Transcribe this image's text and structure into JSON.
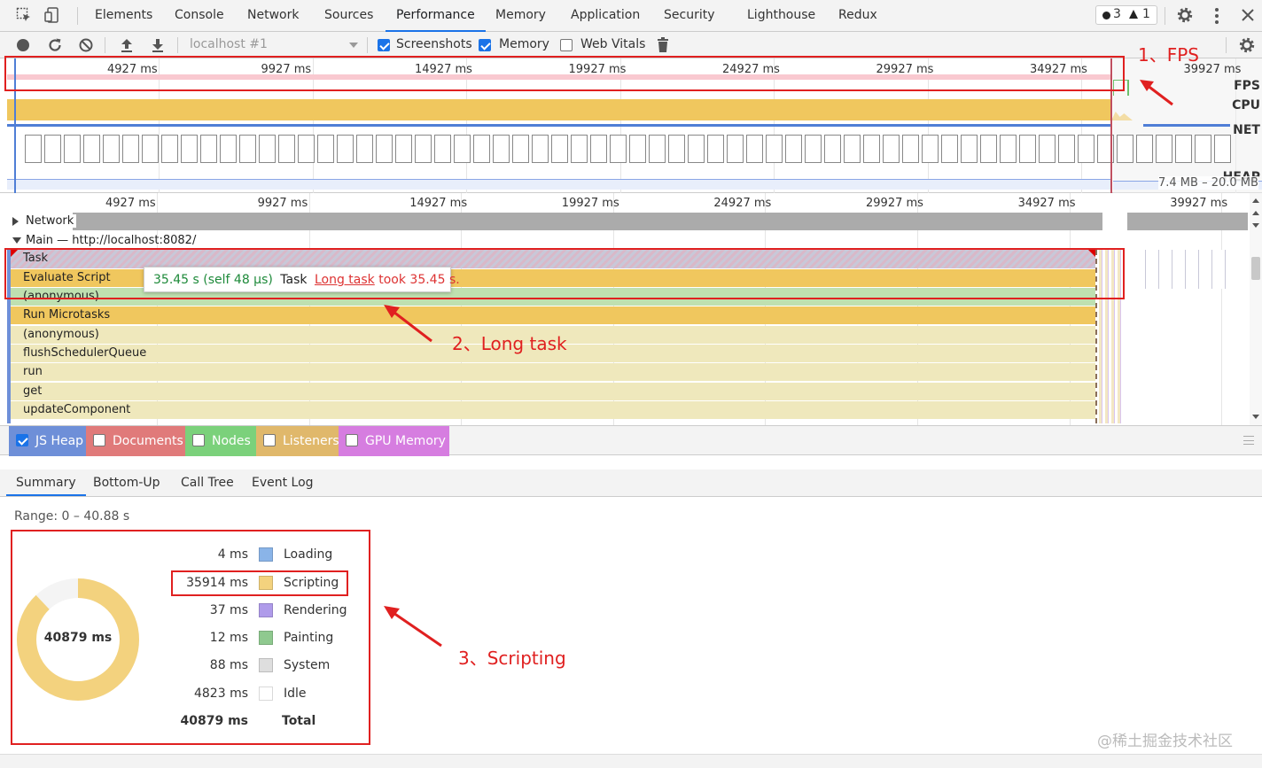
{
  "tabs": [
    {
      "label": "Elements"
    },
    {
      "label": "Console"
    },
    {
      "label": "Network"
    },
    {
      "label": "Sources"
    },
    {
      "label": "Performance"
    },
    {
      "label": "Memory"
    },
    {
      "label": "Application"
    },
    {
      "label": "Security"
    },
    {
      "label": "Lighthouse"
    },
    {
      "label": "Redux"
    }
  ],
  "issues": {
    "errors": "3",
    "warnings": "1"
  },
  "toolbar": {
    "target": "localhost #1",
    "screenshots_label": "Screenshots",
    "memory_label": "Memory",
    "webvitals_label": "Web Vitals"
  },
  "overview": {
    "ticks": [
      "4927 ms",
      "9927 ms",
      "14927 ms",
      "19927 ms",
      "24927 ms",
      "29927 ms",
      "34927 ms",
      "39927 ms"
    ],
    "fps_label": "FPS",
    "cpu_label": "CPU",
    "net_label": "NET",
    "heap_label": "HEAP",
    "heap_range": "7.4 MB – 20.0 MB"
  },
  "flame": {
    "ticks": [
      "4927 ms",
      "9927 ms",
      "14927 ms",
      "19927 ms",
      "24927 ms",
      "29927 ms",
      "34927 ms",
      "39927 ms"
    ],
    "network_label": "Network",
    "main_label": "Main — http://localhost:8082/",
    "rows": [
      "Task",
      "Evaluate Script",
      "(anonymous)",
      "Run Microtasks",
      "(anonymous)",
      "flushSchedulerQueue",
      "run",
      "get",
      "updateComponent"
    ],
    "tooltip": {
      "time": "35.45 s (self 48 µs)",
      "name": "Task",
      "link": "Long task",
      "message": "took 35.45 s."
    }
  },
  "counters": [
    {
      "label": "JS Heap",
      "checked": true,
      "color": "#6e8fd8"
    },
    {
      "label": "Documents",
      "checked": false,
      "color": "#e07a7a"
    },
    {
      "label": "Nodes",
      "checked": false,
      "color": "#7bd17b"
    },
    {
      "label": "Listeners",
      "checked": false,
      "color": "#e0b86b"
    },
    {
      "label": "GPU Memory",
      "checked": false,
      "color": "#d67de0"
    }
  ],
  "bottom_tabs": [
    {
      "label": "Summary"
    },
    {
      "label": "Bottom-Up"
    },
    {
      "label": "Call Tree"
    },
    {
      "label": "Event Log"
    }
  ],
  "summary": {
    "range": "Range: 0 – 40.88 s",
    "donut_total": "40879 ms",
    "legend": [
      {
        "value": "4 ms",
        "name": "Loading",
        "color": "#8ab4e8"
      },
      {
        "value": "35914 ms",
        "name": "Scripting",
        "color": "#f3d27e"
      },
      {
        "value": "37 ms",
        "name": "Rendering",
        "color": "#af9bea"
      },
      {
        "value": "12 ms",
        "name": "Painting",
        "color": "#8fc98f"
      },
      {
        "value": "88 ms",
        "name": "System",
        "color": "#dedede"
      },
      {
        "value": "4823 ms",
        "name": "Idle",
        "color": "#ffffff"
      }
    ],
    "total_value": "40879 ms",
    "total_label": "Total"
  },
  "annotations": {
    "fps": "1、FPS",
    "long_task": "2、Long task",
    "scripting": "3、Scripting"
  },
  "watermark": "@稀土掘金技术社区",
  "colors": {
    "accent": "#1a73e8",
    "scripting": "#f0c75e",
    "annotation_red": "#e02020"
  }
}
